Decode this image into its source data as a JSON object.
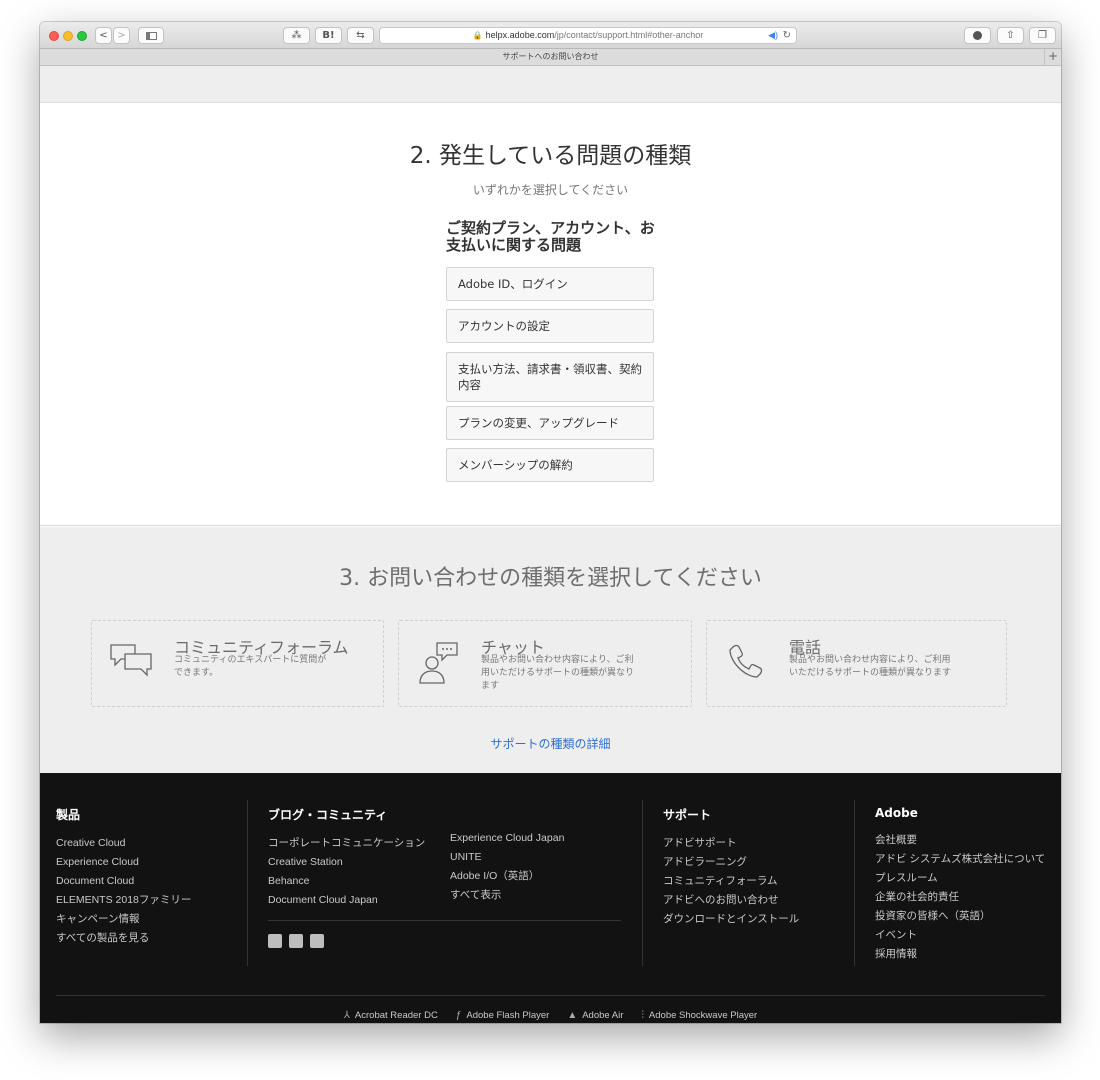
{
  "browser": {
    "url_host": "helpx.adobe.com",
    "url_path": "/jp/contact/support.html#other-anchor",
    "tab_title": "サポートへのお問い合わせ",
    "tab_plus": "+",
    "btn_back": "<",
    "btn_forward": ">",
    "btn_b": "B!",
    "lock": "🔒",
    "audio": "◀︎)",
    "reload": "↻"
  },
  "section2": {
    "title": "2. 発生している問題の種類",
    "subtitle": "いずれかを選択してください",
    "group_title": "ご契約プラン、アカウント、お支払いに関する問題",
    "options": [
      "Adobe ID、ログイン",
      "アカウントの設定",
      "支払い方法、請求書・領収書、契約内容",
      "プランの変更、アップグレード",
      "メンバーシップの解約"
    ]
  },
  "section3": {
    "title": "3. お問い合わせの種類を選択してください",
    "cards": [
      {
        "title": "コミュニティフォーラム",
        "desc": "コミュニティのエキスパートに質問ができます。",
        "icon": "chat-bubbles-icon"
      },
      {
        "title": "チャット",
        "desc": "製品やお問い合わせ内容により、ご利用いただけるサポートの種類が異なります",
        "icon": "agent-chat-icon"
      },
      {
        "title": "電話",
        "desc": "製品やお問い合わせ内容により、ご利用いただけるサポートの種類が異なります",
        "icon": "phone-icon"
      }
    ],
    "more_link": "サポートの種類の詳細"
  },
  "footer": {
    "products": {
      "heading": "製品",
      "links": [
        "Creative Cloud",
        "Experience Cloud",
        "Document Cloud",
        "ELEMENTS 2018ファミリー",
        "キャンペーン情報",
        "すべての製品を見る"
      ]
    },
    "blog": {
      "heading": "ブログ・コミュニティ",
      "links_a": [
        "コーポレートコミュニケーション",
        "Creative Station",
        "Behance",
        "Document Cloud Japan"
      ],
      "links_b": [
        "Experience Cloud Japan",
        "UNITE",
        "Adobe I/O（英語）",
        "すべて表示"
      ]
    },
    "support": {
      "heading": "サポート",
      "links": [
        "アドビサポート",
        "アドビラーニング",
        "コミュニティフォーラム",
        "アドビへのお問い合わせ",
        "ダウンロードとインストール"
      ]
    },
    "adobe": {
      "heading": "Adobe",
      "links": [
        "会社概要",
        "アドビ システムズ株式会社について",
        "プレスルーム",
        "企業の社会的責任",
        "投資家の皆様へ（英語）",
        "イベント",
        "採用情報"
      ]
    },
    "players": [
      "Acrobat Reader DC",
      "Adobe Flash Player",
      "Adobe Air",
      "Adobe Shockwave Player"
    ]
  }
}
